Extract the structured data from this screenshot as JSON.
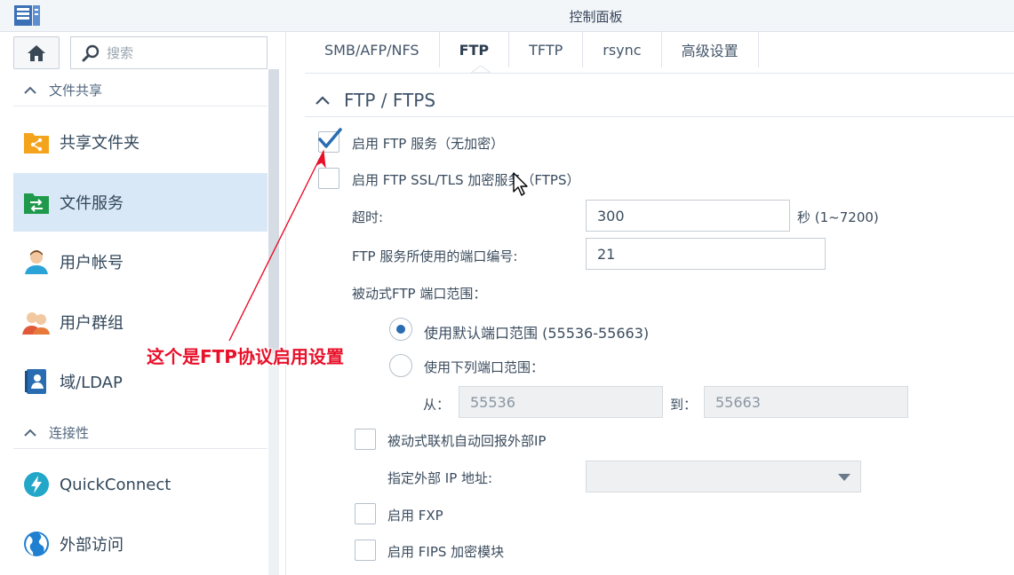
{
  "window": {
    "title": "控制面板"
  },
  "sidebar": {
    "search_placeholder": "搜索",
    "sections": [
      {
        "label": "文件共享"
      },
      {
        "label": "连接性"
      }
    ],
    "items": [
      {
        "label": "共享文件夹",
        "icon": "shared-folder-icon"
      },
      {
        "label": "文件服务",
        "icon": "file-services-icon",
        "active": true
      },
      {
        "label": "用户帐号",
        "icon": "user-icon"
      },
      {
        "label": "用户群组",
        "icon": "group-icon"
      },
      {
        "label": "域/LDAP",
        "icon": "domain-ldap-icon"
      },
      {
        "label": "QuickConnect",
        "icon": "quickconnect-icon"
      },
      {
        "label": "外部访问",
        "icon": "globe-icon"
      }
    ]
  },
  "tabs": [
    {
      "label": "SMB/AFP/NFS"
    },
    {
      "label": "FTP",
      "active": true
    },
    {
      "label": "TFTP"
    },
    {
      "label": "rsync"
    },
    {
      "label": "高级设置"
    }
  ],
  "panel": {
    "title": "FTP / FTPS",
    "enable_ftp": {
      "label": "启用 FTP 服务（无加密）",
      "checked": true
    },
    "enable_ftps": {
      "label": "启用 FTP SSL/TLS 加密服务（FTPS）",
      "checked": false
    },
    "timeout": {
      "label": "超时:",
      "value": "300",
      "unit": "秒 (1~7200)"
    },
    "port": {
      "label": "FTP 服务所使用的端口编号:",
      "value": "21"
    },
    "passive_range_label": "被动式FTP 端口范围：",
    "default_range": {
      "label": "使用默认端口范围 (55536-55663)",
      "selected": true
    },
    "custom_range": {
      "label": "使用下列端口范围：",
      "selected": false
    },
    "from_label": "从：",
    "from_value": "55536",
    "to_label": "到：",
    "to_value": "55663",
    "report_external_ip": {
      "label": "被动式联机自动回报外部IP",
      "checked": false
    },
    "external_ip": {
      "label": "指定外部 IP 地址:",
      "value": ""
    },
    "enable_fxp": {
      "label": "启用 FXP",
      "checked": false
    },
    "enable_fips": {
      "label": "启用 FIPS 加密模块",
      "checked": false
    }
  },
  "annotation": {
    "text": "这个是FTP协议启用设置",
    "color": "#e8102a"
  },
  "colors": {
    "accent": "#2a6cb2",
    "active_bg": "#d8e8f6"
  }
}
